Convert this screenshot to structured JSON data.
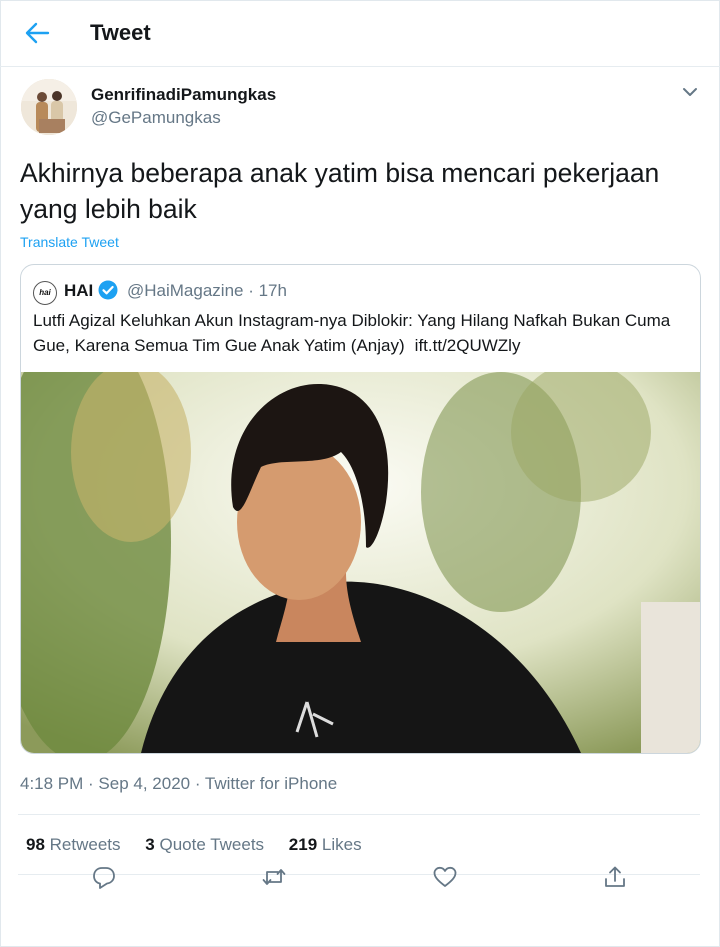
{
  "header": {
    "title": "Tweet"
  },
  "author": {
    "display_name": "GenrifinadiPamungkas",
    "handle": "@GePamungkas"
  },
  "tweet": {
    "text": "Akhirnya beberapa anak yatim bisa mencari pekerjaan yang lebih baik",
    "translate_label": "Translate Tweet"
  },
  "quote": {
    "name": "HAI",
    "handle_time": "@HaiMagazine · 17h",
    "logo_text": "hai",
    "text": "Lutfi Agizal Keluhkan Akun Instagram-nya Diblokir: Yang Hilang Nafkah Bukan Cuma Gue, Karena Semua Tim Gue Anak Yatim (Anjay)",
    "link": "ift.tt/2QUWZly"
  },
  "meta": "4:18 PM · Sep 4, 2020 · Twitter for iPhone",
  "stats": {
    "retweets_count": "98",
    "retweets_label": "Retweets",
    "quotes_count": "3",
    "quotes_label": "Quote Tweets",
    "likes_count": "219",
    "likes_label": "Likes"
  },
  "icons": {
    "back": "arrow-left-icon",
    "caret": "chevron-down-icon",
    "verified": "verified-badge-icon",
    "reply": "reply-icon",
    "retweet": "retweet-icon",
    "like": "heart-icon",
    "share": "share-icon"
  },
  "colors": {
    "accent": "#1da1f2",
    "text": "#14171a",
    "muted": "#657786",
    "border": "#e6ecf0"
  }
}
